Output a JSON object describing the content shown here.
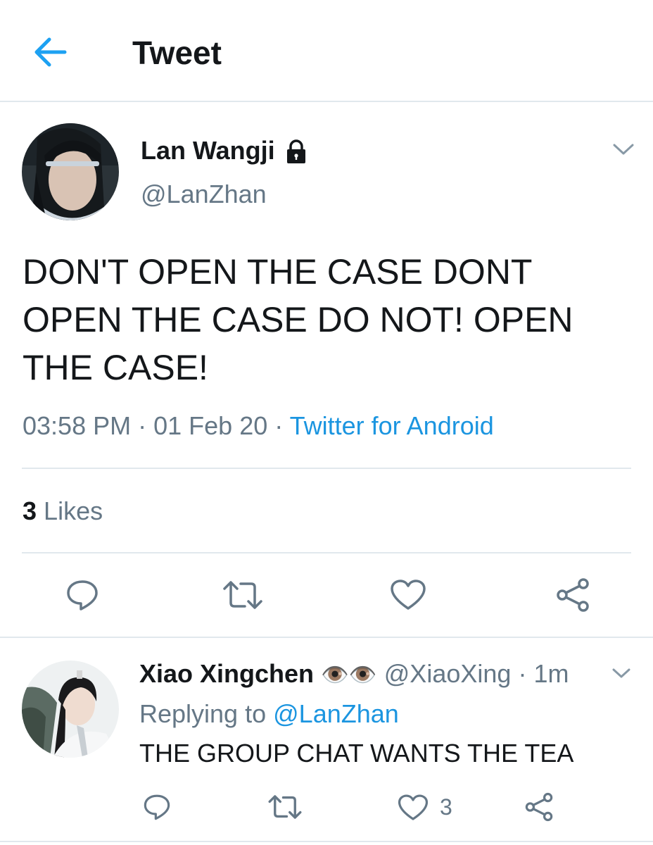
{
  "header": {
    "back_icon": "arrow-left-icon",
    "title": "Tweet",
    "accent_color": "#1da1f2"
  },
  "tweet": {
    "author_name": "Lan Wangji",
    "protected_icon": "lock-icon",
    "handle": "@LanZhan",
    "text": "DON'T OPEN THE CASE DONT OPEN THE CASE DO NOT! OPEN THE CASE!",
    "time": "03:58 PM",
    "date": "01 Feb 20",
    "separator": "·",
    "source": "Twitter for Android",
    "likes_count": "3",
    "likes_label": "Likes",
    "actions": [
      "reply-icon",
      "retweet-icon",
      "like-icon",
      "share-icon"
    ]
  },
  "reply": {
    "author_name": "Xiao Xingchen",
    "emoji": "👁️👁️",
    "handle": "@XiaoXing",
    "separator": "·",
    "time_ago": "1m",
    "replying_prefix": "Replying to",
    "replying_to": "@LanZhan",
    "text": "THE GROUP CHAT WANTS THE TEA",
    "like_count": "3"
  },
  "colors": {
    "text_primary": "#14171a",
    "text_secondary": "#657786",
    "link": "#1b95e0",
    "divider": "#e1e8ed"
  }
}
